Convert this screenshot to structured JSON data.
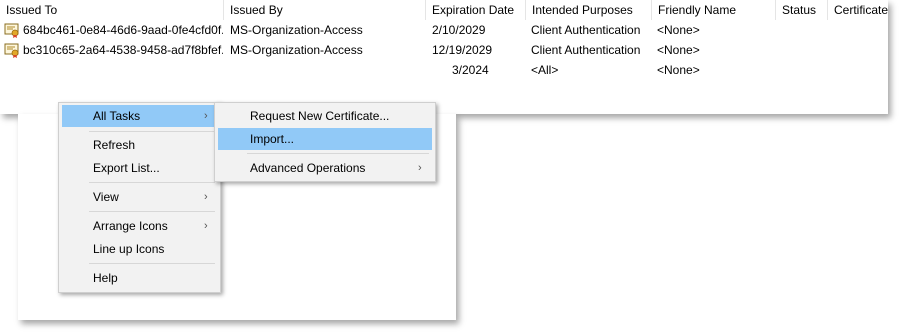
{
  "columns": [
    "Issued To",
    "Issued By",
    "Expiration Date",
    "Intended Purposes",
    "Friendly Name",
    "Status",
    "Certificate"
  ],
  "rows": [
    {
      "issued_to": "684bc461-0e84-46d6-9aad-0fe4cfd0f...",
      "issued_by": "MS-Organization-Access",
      "expiration": "2/10/2029",
      "purposes": "Client Authentication",
      "friendly": "<None>",
      "status": "",
      "icon": "certificate-icon"
    },
    {
      "issued_to": "bc310c65-2a64-4538-9458-ad7f8bfef...",
      "issued_by": "MS-Organization-Access",
      "expiration": "12/19/2029",
      "purposes": "Client Authentication",
      "friendly": "<None>",
      "status": "",
      "icon": "certificate-icon"
    },
    {
      "issued_to": "",
      "issued_by": "",
      "expiration": "3/2024",
      "purposes": "<All>",
      "friendly": "<None>",
      "status": ""
    }
  ],
  "context_menu": {
    "all_tasks": "All Tasks",
    "refresh": "Refresh",
    "export_list": "Export List...",
    "view": "View",
    "arrange_icons": "Arrange Icons",
    "line_up_icons": "Line up Icons",
    "help": "Help"
  },
  "submenu": {
    "request_new": "Request New Certificate...",
    "import": "Import...",
    "advanced": "Advanced Operations"
  },
  "submenu_arrow": "›",
  "colors": {
    "highlight": "#91c9f7",
    "menu_bg": "#f2f2f2"
  }
}
